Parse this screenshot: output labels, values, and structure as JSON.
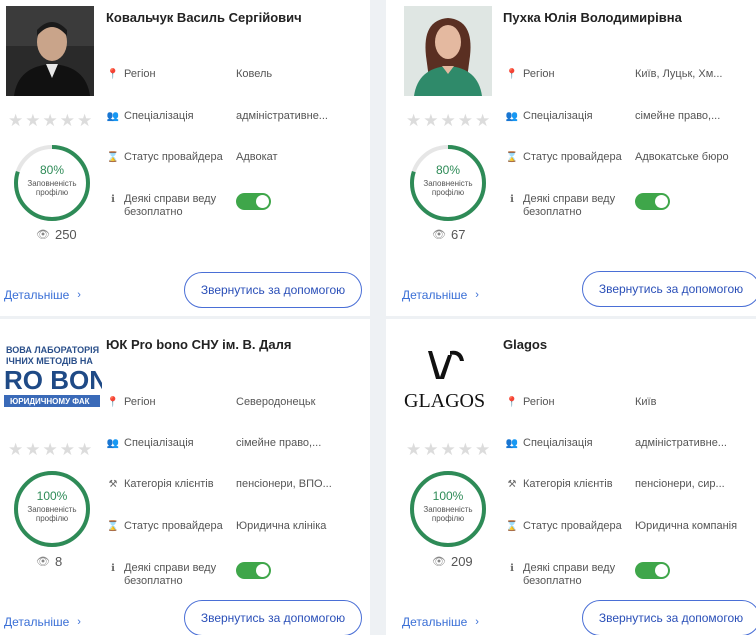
{
  "cards": [
    {
      "name": "Ковальчук Василь Сергійович",
      "progress": 80,
      "progress_text": "80%",
      "progress_label": "Заповненість профілю",
      "views": "250",
      "fields": [
        {
          "icon": "location-pin-icon",
          "label": "Регіон",
          "value": "Ковель"
        },
        {
          "icon": "people-icon",
          "label": "Спеціалізація",
          "value": "адміністративне..."
        },
        {
          "icon": "hourglass-icon",
          "label": "Статус провайдера",
          "value": "Адвокат"
        },
        {
          "icon": "info-icon",
          "label": "Деякі справи веду безоплатно",
          "toggle": true
        }
      ],
      "more_label": "Детальніше",
      "help_label": "Звернутись за допомогою"
    },
    {
      "name": "Пухка Юлія Володимирівна",
      "progress": 80,
      "progress_text": "80%",
      "progress_label": "Заповненість профілю",
      "views": "67",
      "fields": [
        {
          "icon": "location-pin-icon",
          "label": "Регіон",
          "value": "Київ, Луцьк, Хм..."
        },
        {
          "icon": "people-icon",
          "label": "Спеціалізація",
          "value": "сімейне право,..."
        },
        {
          "icon": "hourglass-icon",
          "label": "Статус провайдера",
          "value": "Адвокатське бюро"
        },
        {
          "icon": "info-icon",
          "label": "Деякі справи веду безоплатно",
          "toggle": true
        }
      ],
      "more_label": "Детальніше",
      "help_label": "Звернутись за допомогою"
    },
    {
      "name": "ЮК Pro bono СНУ ім. В. Даля",
      "logo_lines": [
        "ВОВА ЛАБОРАТОРІЯ",
        "ІЧНИХ МЕТОДІВ НА",
        "RO BON",
        "ЮРИДИЧНОМУ ФАК"
      ],
      "progress": 100,
      "progress_text": "100%",
      "progress_label": "Заповненість профілю",
      "views": "8",
      "fields": [
        {
          "icon": "location-pin-icon",
          "label": "Регіон",
          "value": "Северодонецьк"
        },
        {
          "icon": "people-icon",
          "label": "Спеціалізація",
          "value": "сімейне право,..."
        },
        {
          "icon": "gavel-icon",
          "label": "Категорія клієнтів",
          "value": "пенсіонери, ВПО..."
        },
        {
          "icon": "hourglass-icon",
          "label": "Статус провайдера",
          "value": "Юридична клініка"
        },
        {
          "icon": "info-icon",
          "label": "Деякі справи веду безоплатно",
          "toggle": true
        }
      ],
      "more_label": "Детальніше",
      "help_label": "Звернутись за допомогою"
    },
    {
      "name": "Glagos",
      "logo_text": "GLAGOS",
      "progress": 100,
      "progress_text": "100%",
      "progress_label": "Заповненість профілю",
      "views": "209",
      "fields": [
        {
          "icon": "location-pin-icon",
          "label": "Регіон",
          "value": "Київ"
        },
        {
          "icon": "people-icon",
          "label": "Спеціалізація",
          "value": "адміністративне..."
        },
        {
          "icon": "gavel-icon",
          "label": "Категорія клієнтів",
          "value": "пенсіонери, сир..."
        },
        {
          "icon": "hourglass-icon",
          "label": "Статус провайдера",
          "value": "Юридична компанія"
        },
        {
          "icon": "info-icon",
          "label": "Деякі справи веду безоплатно",
          "toggle": true
        }
      ],
      "more_label": "Детальніше",
      "help_label": "Звернутись за допомогою"
    }
  ],
  "colors": {
    "ring": "#2e8b57",
    "toggle": "#3fa64a",
    "link": "#3a6fd6",
    "button_border": "#4a6fd6"
  }
}
